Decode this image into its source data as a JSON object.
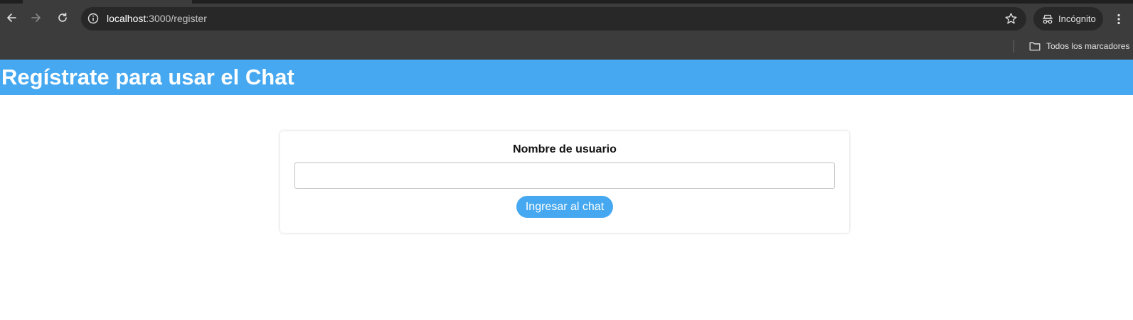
{
  "browser": {
    "url_host": "localhost",
    "url_path": ":3000/register",
    "incognito_label": "Incógnito",
    "bookmarks_all_label": "Todos los marcadores",
    "icons": {
      "back": "arrow-left-icon",
      "forward": "arrow-right-icon",
      "reload": "reload-icon",
      "site_info": "info-icon",
      "bookmark": "star-icon",
      "incognito": "incognito-icon",
      "menu": "kebab-menu-icon",
      "folder": "folder-icon"
    }
  },
  "page": {
    "header_title": "Regístrate para usar el Chat",
    "form": {
      "username_label": "Nombre de usuario",
      "username_value": "",
      "username_placeholder": "",
      "submit_label": "Ingresar al chat"
    }
  },
  "colors": {
    "accent": "#45a8f0",
    "chrome_bg": "#3c3c3c",
    "omnibox_bg": "#282828"
  }
}
